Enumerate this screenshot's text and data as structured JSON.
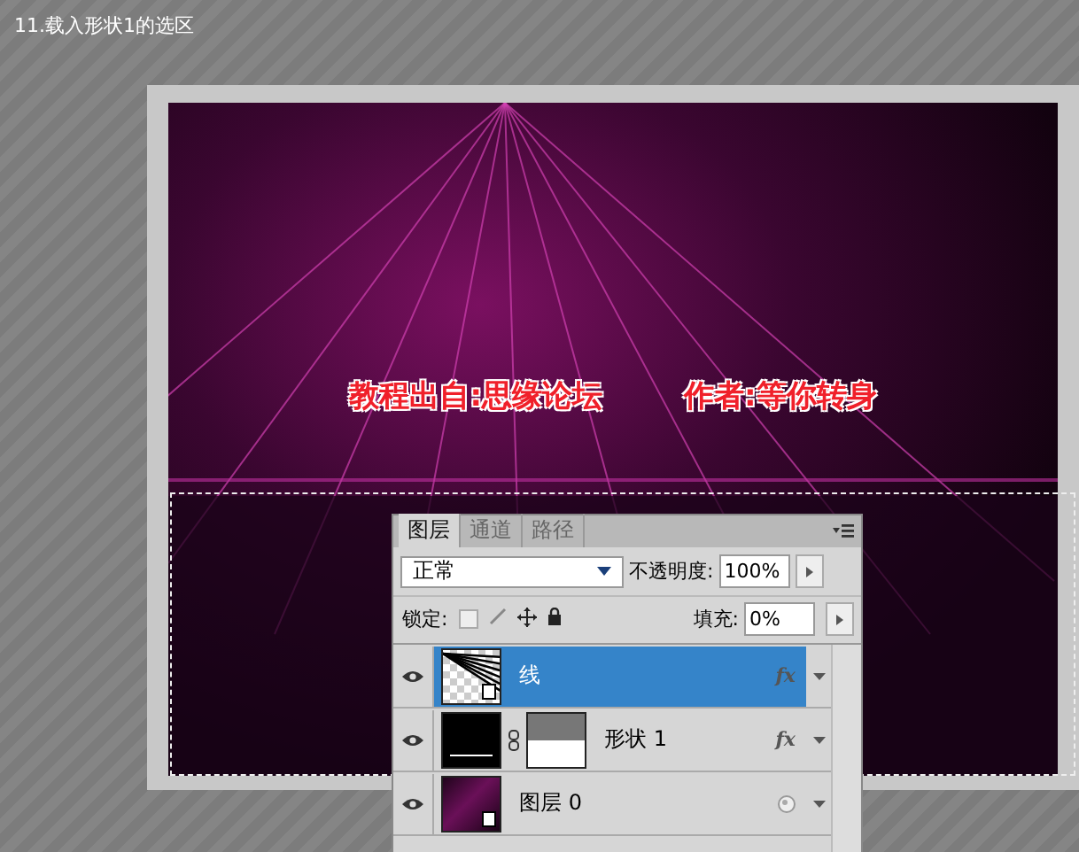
{
  "step_title": "11.载入形状1的选区",
  "captions": [
    {
      "text": "教程出自:思缘论坛"
    },
    {
      "text": "作者:等你转身"
    }
  ],
  "layers_panel": {
    "tabs": [
      {
        "label": "图层",
        "selected": true
      },
      {
        "label": "通道",
        "selected": false
      },
      {
        "label": "路径",
        "selected": false
      }
    ],
    "blend_mode": "正常",
    "opacity": {
      "label": "不透明度:",
      "value": "100%"
    },
    "lock": {
      "label": "锁定:"
    },
    "fill": {
      "label": "填充:",
      "value": "0%"
    },
    "layers": [
      {
        "name": "线",
        "selected": true,
        "visible": true,
        "kind": "smart-lines",
        "effects": "fx"
      },
      {
        "name": "形状 1",
        "selected": false,
        "visible": true,
        "kind": "shape",
        "effects": "fx"
      },
      {
        "name": "图层 0",
        "selected": false,
        "visible": true,
        "kind": "smart-photo"
      }
    ]
  }
}
